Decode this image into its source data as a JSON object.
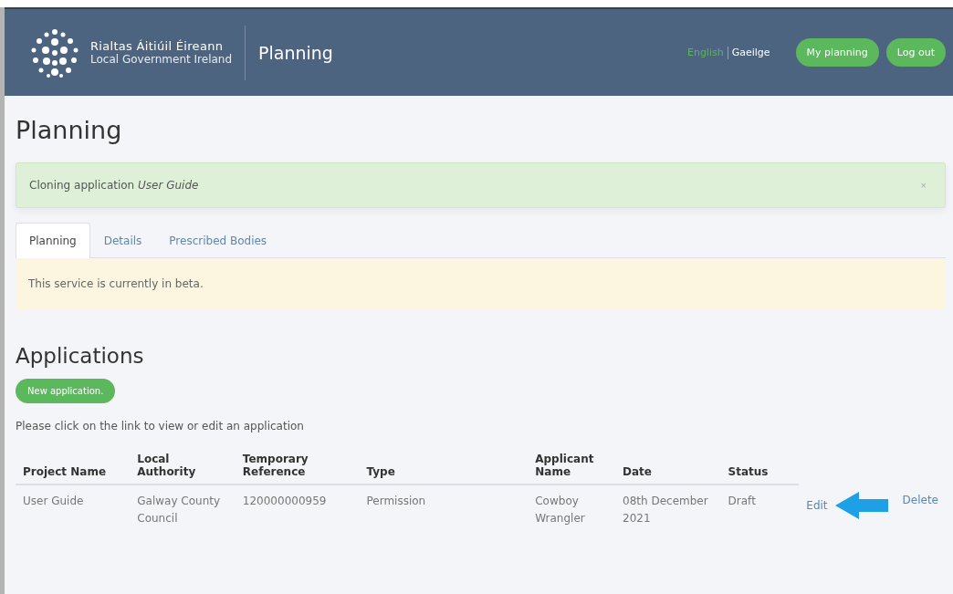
{
  "header": {
    "org_name": "Rialtas Áitiúil Éireann",
    "org_subtitle": "Local Government Ireland",
    "app_title": "Planning",
    "languages": [
      {
        "label": "English",
        "selected": true
      },
      {
        "label": "Gaeilge",
        "selected": false
      }
    ],
    "buttons": [
      "My planning",
      "Log out"
    ]
  },
  "page_title": "Planning",
  "notice": {
    "text": "Cloning application *User Guide*",
    "close": "×"
  },
  "tabs": [
    {
      "label": "Planning",
      "selected": true
    },
    {
      "label": "Details",
      "selected": false
    },
    {
      "label": "Prescribed Bodies",
      "selected": false
    }
  ],
  "beta_notice": "This service is currently in beta.",
  "applications": {
    "title": "Applications",
    "new_button": "New application.",
    "hint": "Please click on the link to view or edit an application",
    "table": {
      "columns": [
        "Project Name",
        "Local Authority",
        "Temporary Reference",
        "Type",
        "Applicant Name",
        "Date",
        "Status"
      ],
      "rows": [
        {
          "cells": [
            "User Guide",
            "Galway County Council",
            "120000000959",
            "Permission",
            "Cowboy Wrangler",
            "08th December 2021",
            "Draft"
          ],
          "actions": [
            "Edit",
            "Delete"
          ]
        }
      ]
    }
  }
}
